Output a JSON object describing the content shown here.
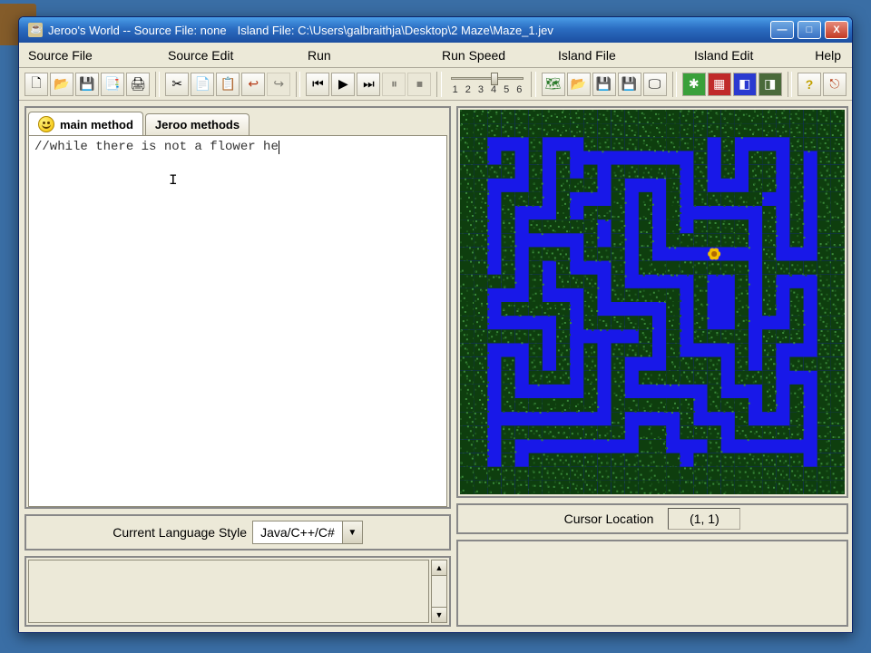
{
  "window": {
    "title_primary": "Jeroo's World -- Source File: none",
    "title_secondary": "Island File: C:\\Users\\galbraithja\\Desktop\\2 Maze\\Maze_1.jev",
    "min": "—",
    "max": "□",
    "close": "X"
  },
  "menus": [
    "Source File",
    "Source Edit",
    "Run",
    "Run Speed",
    "Island File",
    "Island Edit",
    "Help"
  ],
  "toolbar": {
    "new": "🗋",
    "open": "📂",
    "save": "💾",
    "saveas": "📑",
    "print": "🖨",
    "cut": "✂",
    "copy": "📄",
    "paste": "📋",
    "undo": "↩",
    "redo": "↪",
    "rewind": "⏮",
    "play": "▶",
    "ff": "⏭",
    "pause": "⏸",
    "stop": "⏹",
    "g1": "🗺",
    "g2": "📂",
    "g3": "💾",
    "g4": "💾",
    "g5": "🖵",
    "p1": "✱",
    "p2": "▦",
    "p3": "◧",
    "p4": "◨",
    "help": "?",
    "exit": "⎋"
  },
  "speed_labels": [
    "1",
    "2",
    "3",
    "4",
    "5",
    "6"
  ],
  "tabs": {
    "main": "main method",
    "jeroo": "Jeroo methods"
  },
  "editor": {
    "text": "//while there is not a flower he"
  },
  "lang": {
    "label": "Current Language Style",
    "value": "Java/C++/C#"
  },
  "cursor": {
    "label": "Cursor Location",
    "value": "(1, 1)"
  },
  "flower_pos": [
    18,
    10
  ],
  "maze_rows": [
    "############################",
    "############################",
    "##...#...#########.#....####",
    "##.#.#.#.........#.#.##.#.##",
    "####.#.#.#.#####.#.#.##.#.##",
    "##...#.###.#...#.#...##.#.##",
    "##.###.#...#.#.#.#####..#.##",
    "##.#...#.###.#.#......#.#.##",
    "##.#.#####.#.#.#.####.#.#.##",
    "##.#.....#.#.#.######.#.#.##",
    "##.#.###.###.#........#...##",
    "##.#.#.#...#.########.#####",
    "####.#.###.#.....#..#.#...##",
    "##...#...#.#####.#..#.#.#.##",
    "##.#####.#.....#.#..#.#.#.##",
    "##.....#.#####.#.#..#...#.##",
    "######.#.....#.#.####.###.##",
    "##...#.#.#.###.#....#.#...##",
    "##.#.#.#.#.#...####.#.#.####",
    "##.#.###.#.#.######.###...##",
    "##.#.....#.#......#...#.#.##",
    "##.#######.######.###.#.#.##",
    "##.........#....#...#...#.##",
    "##.#########.##.###.#####.##",
    "##.#.........##...#.......##",
    "##.#.###########.########.##",
    "############################",
    "############################"
  ]
}
